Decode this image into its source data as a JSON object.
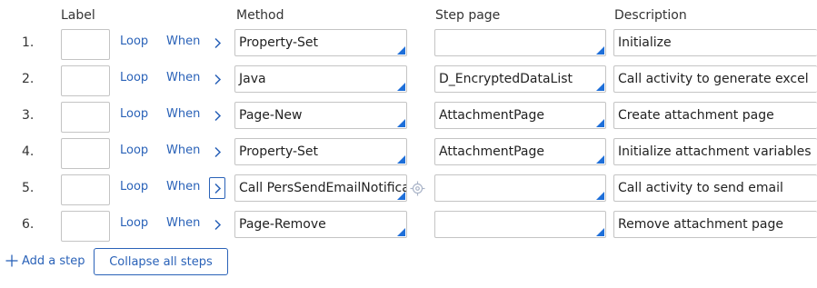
{
  "headers": {
    "label": "Label",
    "method": "Method",
    "step_page": "Step page",
    "description": "Description"
  },
  "colors": {
    "link": "#2a62b8",
    "corner_marker": "#1e6fd9",
    "border": "#c4c4c4",
    "text": "#333333"
  },
  "steps": [
    {
      "num": "1.",
      "label": "",
      "loop": "Loop",
      "when": "When",
      "expand_icon": "chevron-right-icon",
      "method": "Property-Set",
      "step_page": "",
      "description": "Initialize"
    },
    {
      "num": "2.",
      "label": "",
      "loop": "Loop",
      "when": "When",
      "expand_icon": "chevron-right-icon",
      "method": "Java",
      "step_page": "D_EncryptedDataList",
      "description": "Call activity to generate excel"
    },
    {
      "num": "3.",
      "label": "",
      "loop": "Loop",
      "when": "When",
      "expand_icon": "chevron-right-icon",
      "method": "Page-New",
      "step_page": "AttachmentPage",
      "description": "Create attachment page"
    },
    {
      "num": "4.",
      "label": "",
      "loop": "Loop",
      "when": "When",
      "expand_icon": "chevron-right-icon",
      "method": "Property-Set",
      "step_page": "AttachmentPage",
      "description": "Initialize attachment variables"
    },
    {
      "num": "5.",
      "label": "",
      "loop": "Loop",
      "when": "When",
      "expand_icon": "chevron-right-icon",
      "method": "Call PersSendEmailNotificati",
      "step_page": "",
      "description": "Call activity to send email",
      "target_icon": "crosshair-target-icon"
    },
    {
      "num": "6.",
      "label": "",
      "loop": "Loop",
      "when": "When",
      "expand_icon": "chevron-right-icon",
      "method": "Page-Remove",
      "step_page": "",
      "description": "Remove attachment page"
    }
  ],
  "footer": {
    "add_step": "Add a step",
    "add_icon": "plus-icon",
    "collapse": "Collapse all steps"
  }
}
